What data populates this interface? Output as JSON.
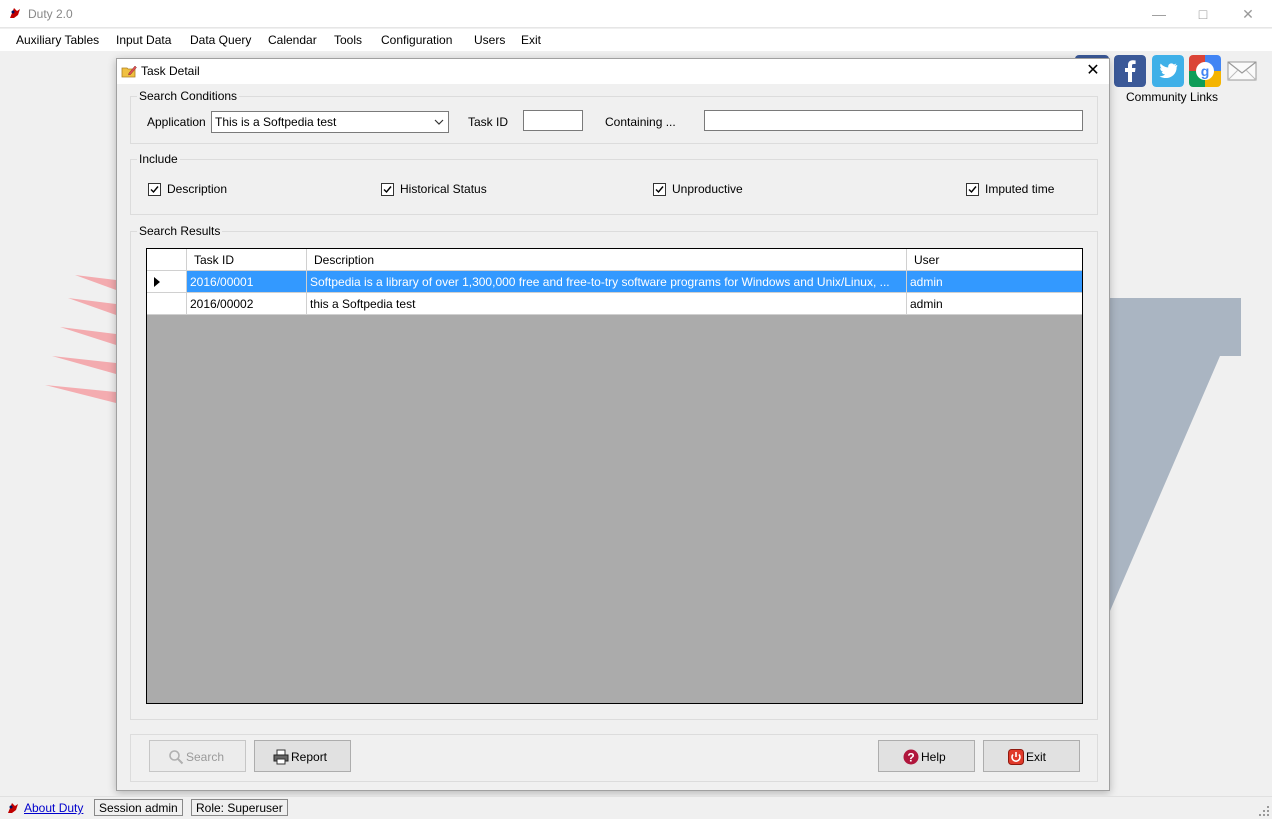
{
  "window": {
    "title": "Duty 2.0"
  },
  "menu": [
    "Auxiliary Tables",
    "Input Data",
    "Data Query",
    "Calendar",
    "Tools",
    "Configuration",
    "Users",
    "Exit"
  ],
  "community": {
    "label": "Community Links",
    "icons": [
      "facebook-icon",
      "twitter-icon",
      "google-icon",
      "mail-icon"
    ]
  },
  "dialog": {
    "title": "Task Detail",
    "search_conditions": {
      "label": "Search Conditions",
      "application_label": "Application",
      "application_value": "This is a Softpedia test",
      "task_id_label": "Task ID",
      "task_id_value": "",
      "containing_label": "Containing ...",
      "containing_value": ""
    },
    "include": {
      "label": "Include",
      "options": [
        {
          "label": "Description",
          "checked": true
        },
        {
          "label": "Historical Status",
          "checked": true
        },
        {
          "label": "Unproductive",
          "checked": true
        },
        {
          "label": "Imputed time",
          "checked": true
        }
      ]
    },
    "results": {
      "label": "Search Results",
      "columns": [
        "Task ID",
        "Description",
        "User"
      ],
      "rows": [
        {
          "task_id": "2016/00001",
          "description": "Softpedia is a library of over 1,300,000 free and free-to-try software programs for Windows and Unix/Linux, ...",
          "user": "admin",
          "selected": true
        },
        {
          "task_id": "2016/00002",
          "description": "this a Softpedia test",
          "user": "admin",
          "selected": false
        }
      ]
    },
    "buttons": {
      "search": "Search",
      "report": "Report",
      "help": "Help",
      "exit": "Exit"
    }
  },
  "statusbar": {
    "about": "About Duty",
    "session": "Session admin",
    "role": "Role: Superuser"
  },
  "colors": {
    "selection": "#3399ff",
    "grid_bg": "#ababab",
    "link": "#0000cc"
  }
}
